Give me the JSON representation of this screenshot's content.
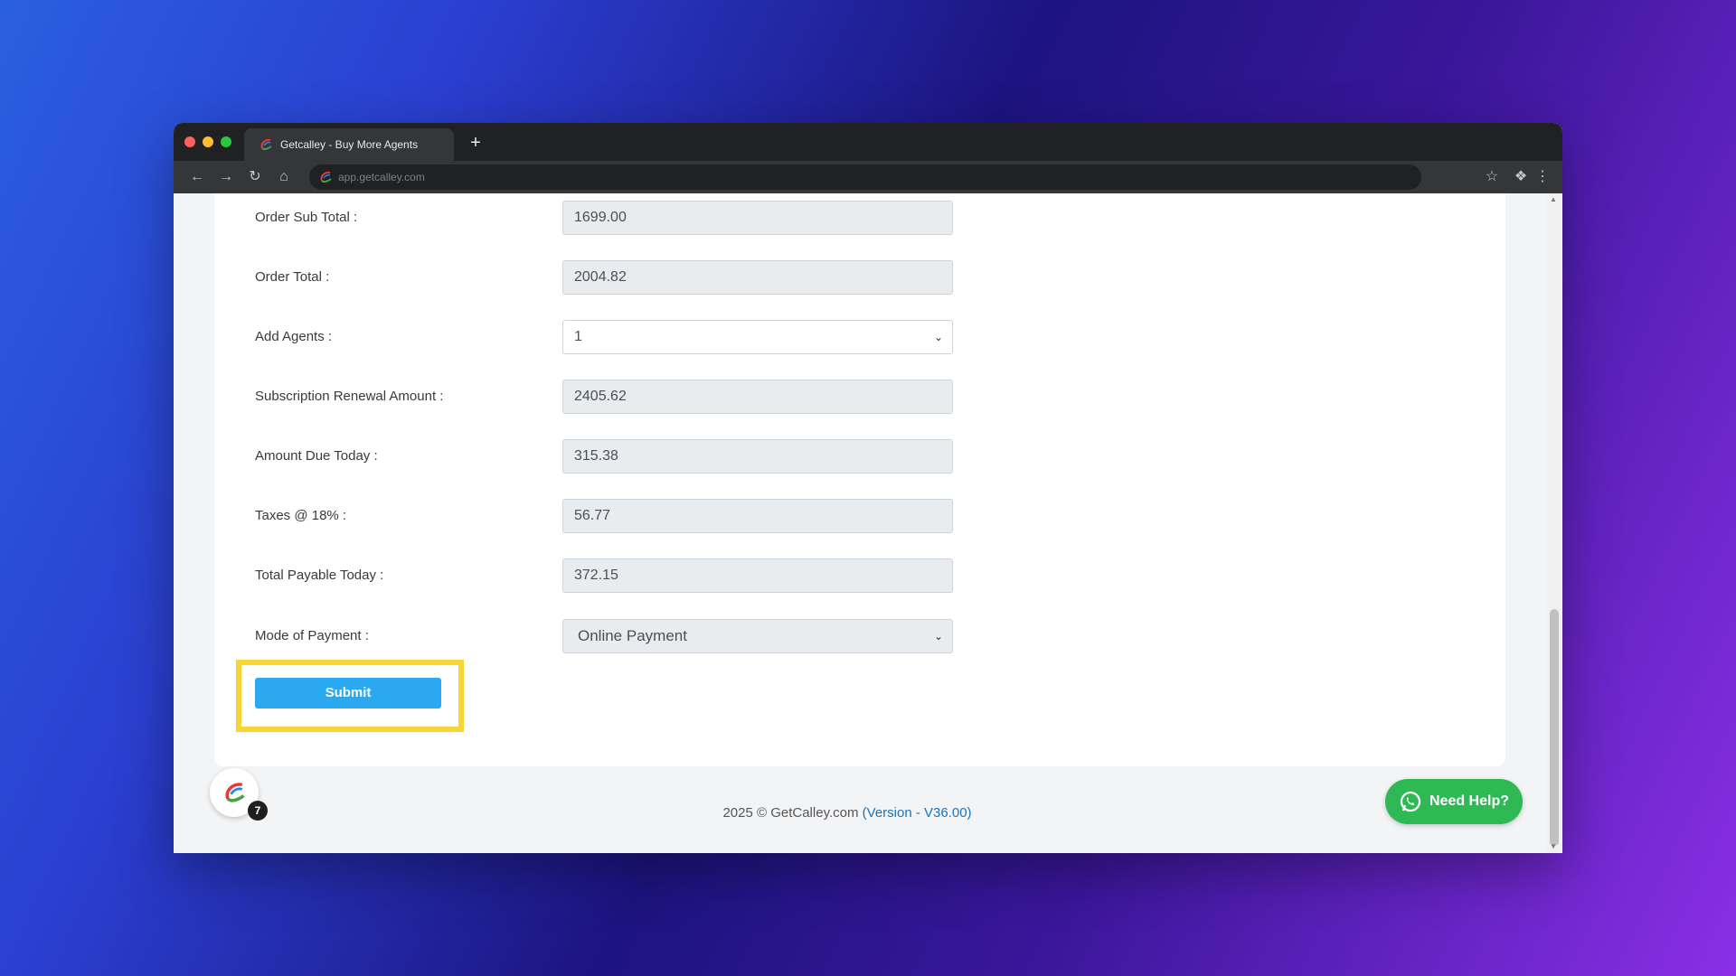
{
  "browser": {
    "tab_title": "Getcalley - Buy More Agents",
    "new_tab_symbol": "+",
    "url": "app.getcalley.com"
  },
  "form": {
    "fields": [
      {
        "label": "Order Sub Total :",
        "value": "1699.00"
      },
      {
        "label": "Order Total :",
        "value": "2004.82"
      },
      {
        "label": "Add Agents :",
        "value": "1"
      },
      {
        "label": "Subscription Renewal Amount :",
        "value": "2405.62"
      },
      {
        "label": "Amount Due Today :",
        "value": "315.38"
      },
      {
        "label": "Taxes @ 18% :",
        "value": "56.77"
      },
      {
        "label": "Total Payable Today :",
        "value": "372.15"
      },
      {
        "label": "Mode of Payment :",
        "value": "Online Payment"
      }
    ],
    "submit_label": "Submit"
  },
  "footer": {
    "copyright": "2025 © GetCalley.com",
    "version": "(Version - V36.00)"
  },
  "widgets": {
    "chat_badge_count": "7",
    "need_help_label": "Need Help?"
  },
  "colors": {
    "submit_button": "#2aa9f0",
    "highlight_border": "#f7d634",
    "need_help": "#2fb955"
  }
}
